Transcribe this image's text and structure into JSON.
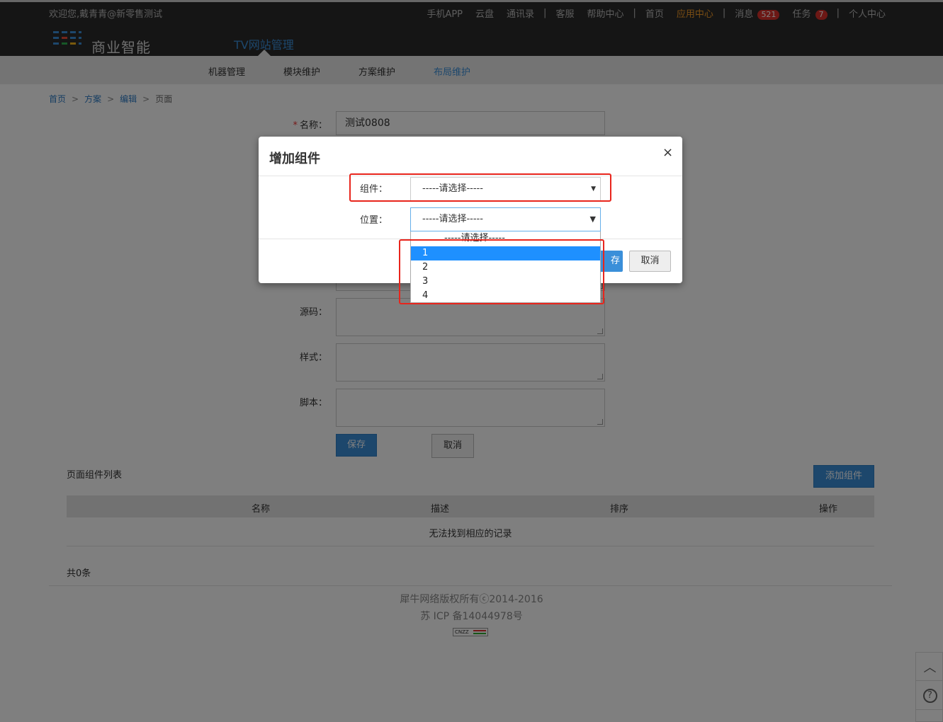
{
  "header": {
    "welcome": "欢迎您,戴青青@新零售测试",
    "links": {
      "mobile_app": "手机APP",
      "cloud": "云盘",
      "contacts": "通讯录",
      "service": "客服",
      "help": "帮助中心",
      "home": "首页",
      "app_center": "应用中心",
      "messages": "消息",
      "messages_count": "521",
      "tasks": "任务",
      "tasks_count": "7",
      "profile": "个人中心"
    },
    "brand": "商业智能",
    "system_name": "TV网站管理"
  },
  "subnav": {
    "items": [
      "机器管理",
      "模块维护",
      "方案维护",
      "布局维护"
    ],
    "active": "布局维护"
  },
  "breadcrumb": {
    "items": [
      "首页",
      "方案",
      "编辑",
      "页面"
    ]
  },
  "form": {
    "name_label": "名称：",
    "name_required_mark": "*",
    "name_value": "测试0808",
    "source_label": "源码：",
    "style_label": "样式：",
    "script_label": "脚本：",
    "save_label": "保存",
    "cancel_label": "取消"
  },
  "component_list": {
    "title": "页面组件列表",
    "add_button": "添加组件",
    "columns": [
      "名称",
      "描述",
      "排序",
      "操作"
    ],
    "empty_text": "无法找到相应的记录",
    "total": "共0条"
  },
  "footer": {
    "copyright": "犀牛网络版权所有ⓒ2014-2016",
    "icp": "苏 ICP 备14044978号",
    "badge_text": "CNZZ"
  },
  "modal": {
    "title": "增加组件",
    "close_symbol": "×",
    "component_label": "组件：",
    "component_value": "-----请选择-----",
    "position_label": "位置：",
    "position_value": "-----请选择-----",
    "save_label": "保存",
    "save_visible_text": "存",
    "cancel_label": "取消"
  },
  "position_dropdown": {
    "options": [
      "-----请选择-----",
      "1",
      "2",
      "3",
      "4"
    ],
    "highlighted": "1"
  },
  "side_tools": {
    "up_symbol": "︿",
    "help_symbol": "?"
  },
  "colors": {
    "accent_blue": "#3a8fd9",
    "highlight": "#1e90ff",
    "annotation_red": "#e8251c",
    "app_center": "#f39a26"
  }
}
